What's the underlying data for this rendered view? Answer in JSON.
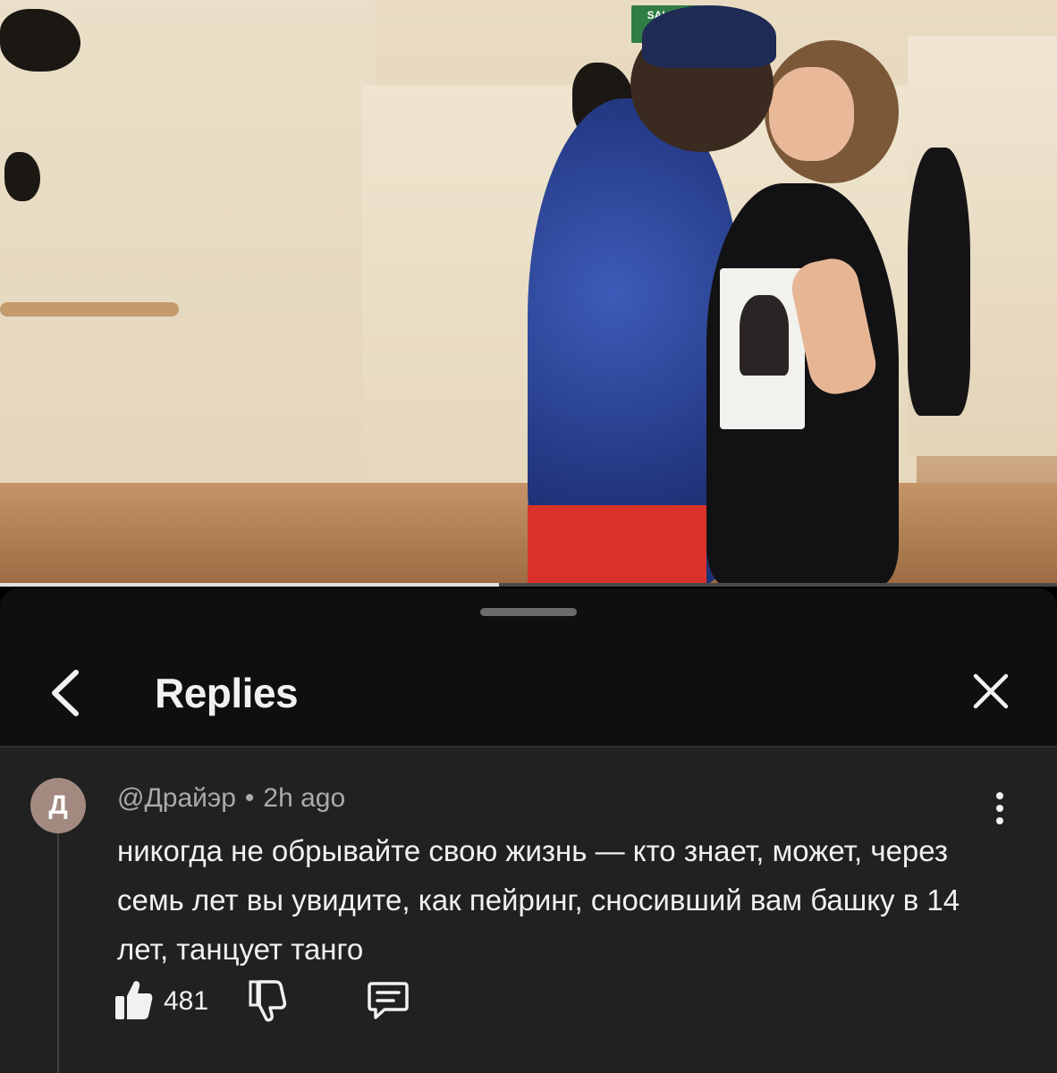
{
  "video": {
    "exit_sign": "SALIDA",
    "progress_fraction": 0.472
  },
  "panel": {
    "title": "Replies"
  },
  "comment": {
    "avatar_letter": "Д",
    "author": "@Драйэр",
    "separator": "•",
    "time": "2h ago",
    "text": "никогда не обрывайте свою жизнь — кто знает, может, через семь лет вы увидите, как пейринг, сносивший вам башку в 14 лет, танцует танго",
    "likes": "481"
  },
  "icons": {
    "back": "chevron-left-icon",
    "close": "close-icon",
    "menu": "more-vertical-icon",
    "like": "thumbs-up-icon",
    "dislike": "thumbs-down-icon",
    "reply": "comment-icon"
  },
  "colors": {
    "panel_bg": "#0f0f0f",
    "comment_bg": "#212121",
    "text_primary": "#f1f1f1",
    "text_secondary": "#aaaaaa",
    "avatar_bg": "#a38a80"
  }
}
